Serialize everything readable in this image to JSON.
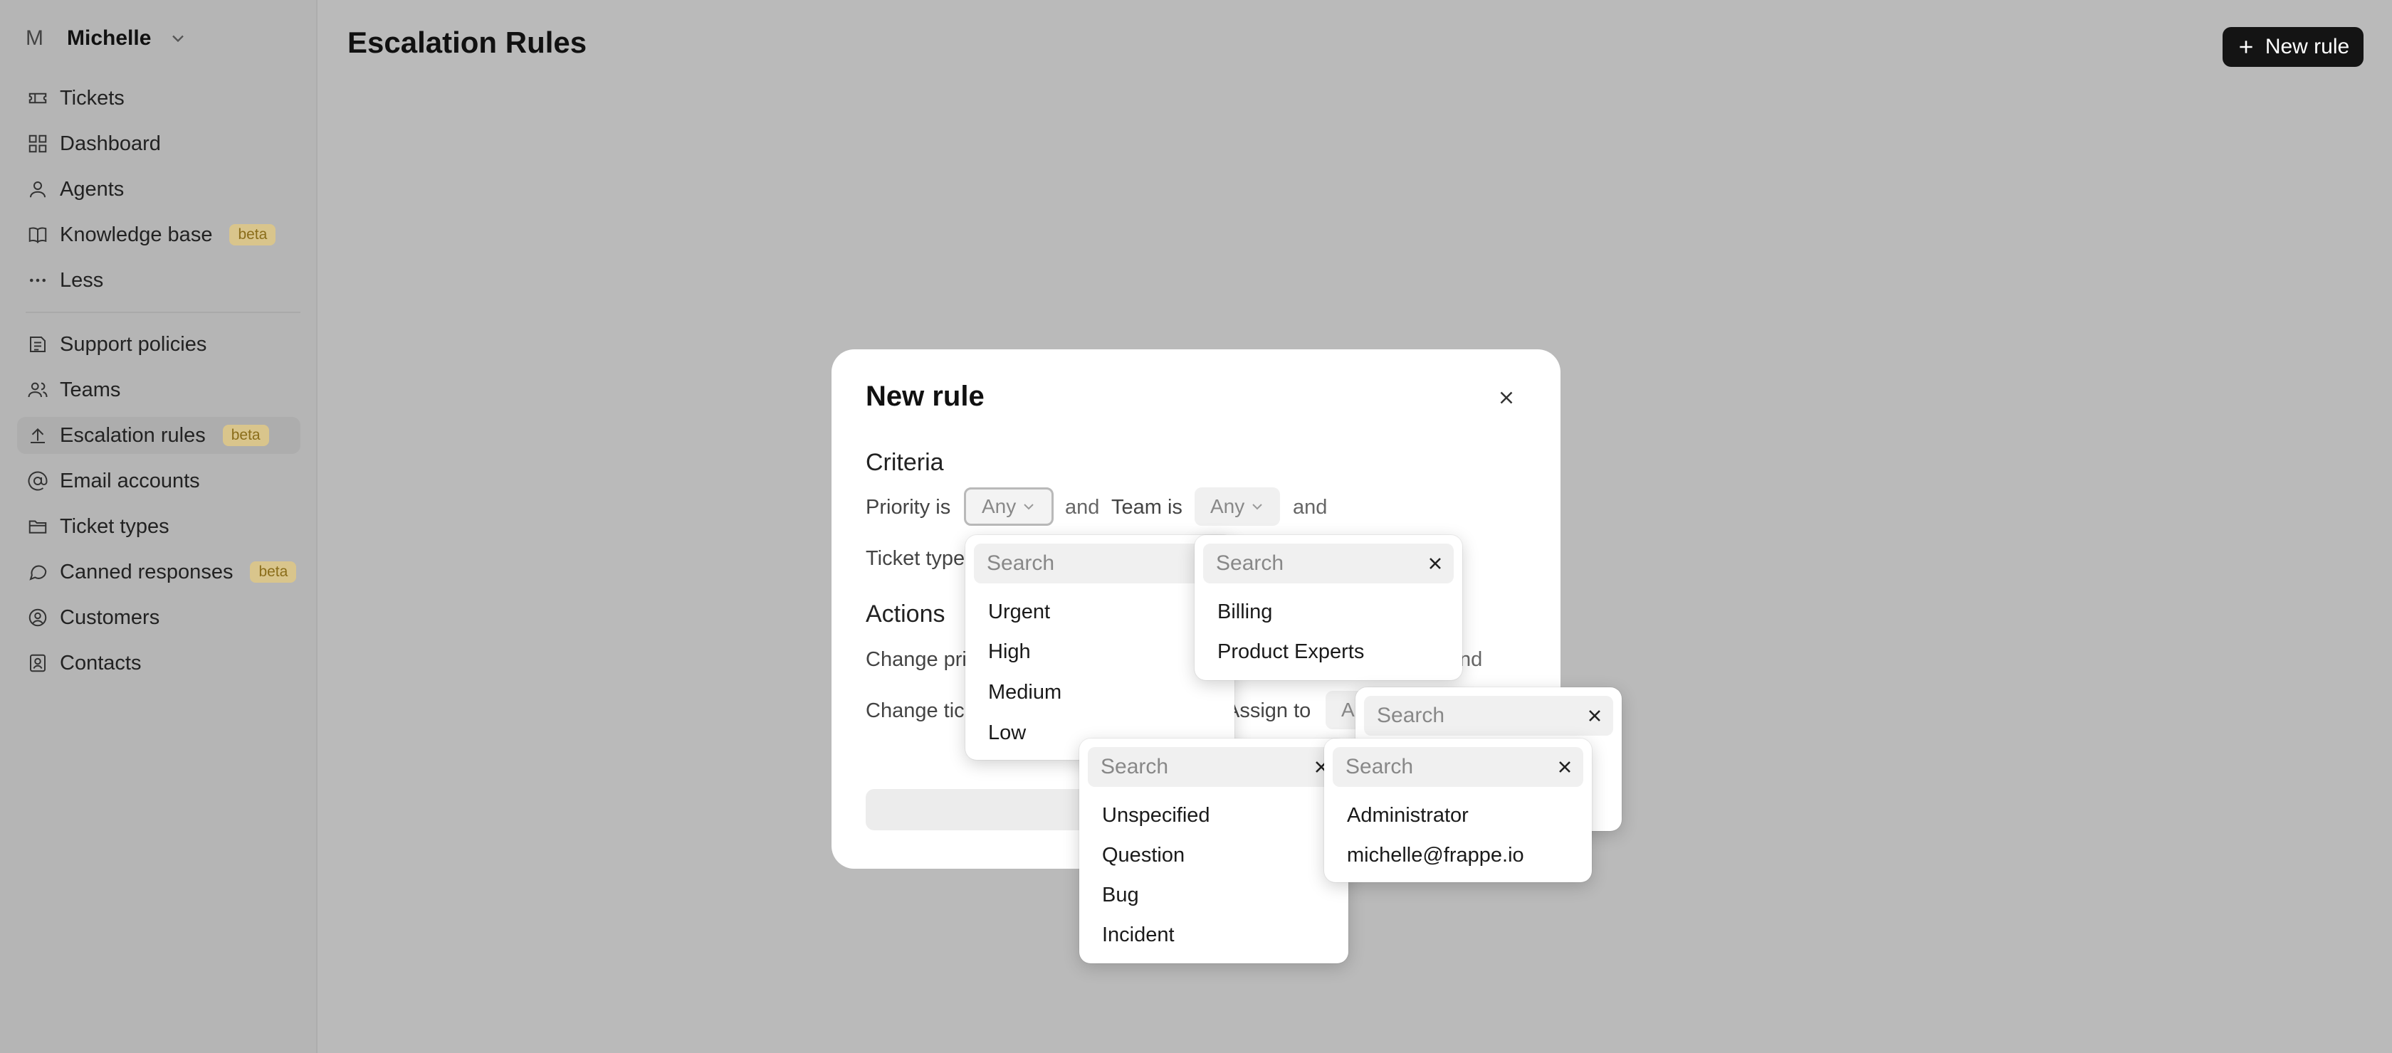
{
  "account": {
    "initial": "M",
    "name": "Michelle"
  },
  "nav": {
    "primary": [
      {
        "label": "Tickets",
        "icon": "ticket-icon"
      },
      {
        "label": "Dashboard",
        "icon": "dashboard-icon"
      },
      {
        "label": "Agents",
        "icon": "user-icon"
      },
      {
        "label": "Knowledge base",
        "icon": "book-icon",
        "badge": "beta"
      },
      {
        "label": "Less",
        "icon": "ellipsis-icon"
      }
    ],
    "secondary": [
      {
        "label": "Support policies",
        "icon": "policy-icon"
      },
      {
        "label": "Teams",
        "icon": "users-icon"
      },
      {
        "label": "Escalation rules",
        "icon": "upload-icon",
        "badge": "beta",
        "active": true
      },
      {
        "label": "Email accounts",
        "icon": "at-icon"
      },
      {
        "label": "Ticket types",
        "icon": "folder-icon"
      },
      {
        "label": "Canned responses",
        "icon": "message-icon",
        "badge": "beta"
      },
      {
        "label": "Customers",
        "icon": "user-circle-icon"
      },
      {
        "label": "Contacts",
        "icon": "contact-icon"
      }
    ]
  },
  "page": {
    "title": "Escalation Rules",
    "new_button": "New rule"
  },
  "modal": {
    "title": "New rule",
    "criteria_heading": "Criteria",
    "priority_label": "Priority is",
    "priority_value": "Any",
    "and_1": "and",
    "team_label": "Team is",
    "team_value": "Any",
    "and_2": "and",
    "ticket_type_label": "Ticket type",
    "actions_heading": "Actions",
    "change_priority_label": "Change pri",
    "and_3": "nd",
    "change_ticket_label": "Change tic",
    "assign_to_label": "Assign to",
    "assign_value": "A"
  },
  "dropdowns": {
    "priority": {
      "placeholder": "Search",
      "options": [
        "Urgent",
        "High",
        "Medium",
        "Low"
      ]
    },
    "team": {
      "placeholder": "Search",
      "options": [
        "Billing",
        "Product Experts"
      ]
    },
    "ticket_type": {
      "placeholder": "Search",
      "options": [
        "Unspecified",
        "Question",
        "Bug",
        "Incident"
      ]
    },
    "assign_team": {
      "placeholder": "Search"
    },
    "assign_agent": {
      "placeholder": "Search",
      "options": [
        "Administrator",
        "michelle@frappe.io"
      ]
    }
  }
}
